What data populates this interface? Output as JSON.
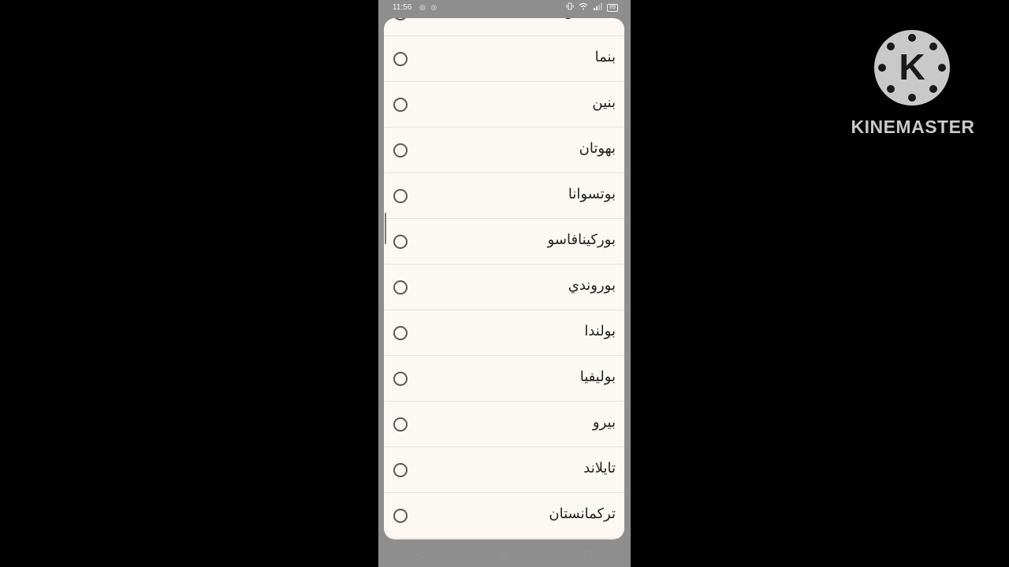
{
  "status_bar": {
    "time": "11:56",
    "app_icons": "◎ ◎",
    "battery": "89"
  },
  "list": {
    "items": [
      {
        "label": "بنغلاديش",
        "selected": false
      },
      {
        "label": "بنما",
        "selected": false
      },
      {
        "label": "بنين",
        "selected": false
      },
      {
        "label": "بهوتان",
        "selected": false
      },
      {
        "label": "بوتسوانا",
        "selected": false
      },
      {
        "label": "بوركينافاسو",
        "selected": false
      },
      {
        "label": "بوروندي",
        "selected": false
      },
      {
        "label": "بولندا",
        "selected": false
      },
      {
        "label": "بوليفيا",
        "selected": false
      },
      {
        "label": "بيرو",
        "selected": false
      },
      {
        "label": "تايلاند",
        "selected": false
      },
      {
        "label": "تركمانستان",
        "selected": false
      }
    ]
  },
  "nav_bar": {
    "back_icon": "◁",
    "home_icon": "○",
    "recents_icon": "□"
  },
  "watermark": {
    "logo_letter": "K",
    "brand": "KINEMASTER"
  }
}
